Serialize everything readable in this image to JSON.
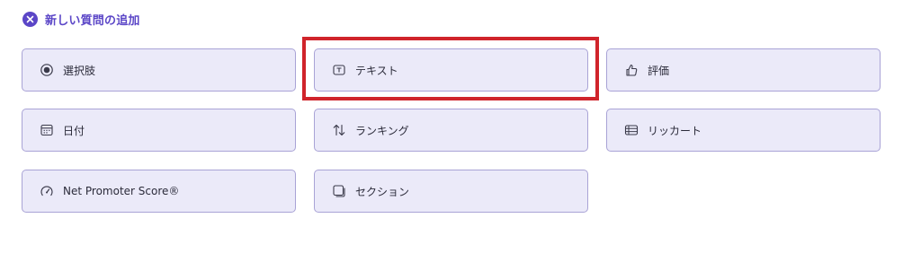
{
  "header": {
    "title": "新しい質問の追加"
  },
  "tiles": [
    {
      "label": "選択肢",
      "icon": "radio-icon"
    },
    {
      "label": "テキスト",
      "icon": "text-box-icon"
    },
    {
      "label": "評価",
      "icon": "thumbs-up-icon"
    },
    {
      "label": "日付",
      "icon": "calendar-icon"
    },
    {
      "label": "ランキング",
      "icon": "sort-arrows-icon"
    },
    {
      "label": "リッカート",
      "icon": "likert-grid-icon"
    },
    {
      "label": "Net Promoter Score®",
      "icon": "gauge-icon"
    },
    {
      "label": "セクション",
      "icon": "section-icon"
    }
  ],
  "colors": {
    "accent": "#5b46c7",
    "tile_bg": "#ebeaf9",
    "tile_border": "#a9a3d6",
    "highlight": "#d0242b"
  }
}
